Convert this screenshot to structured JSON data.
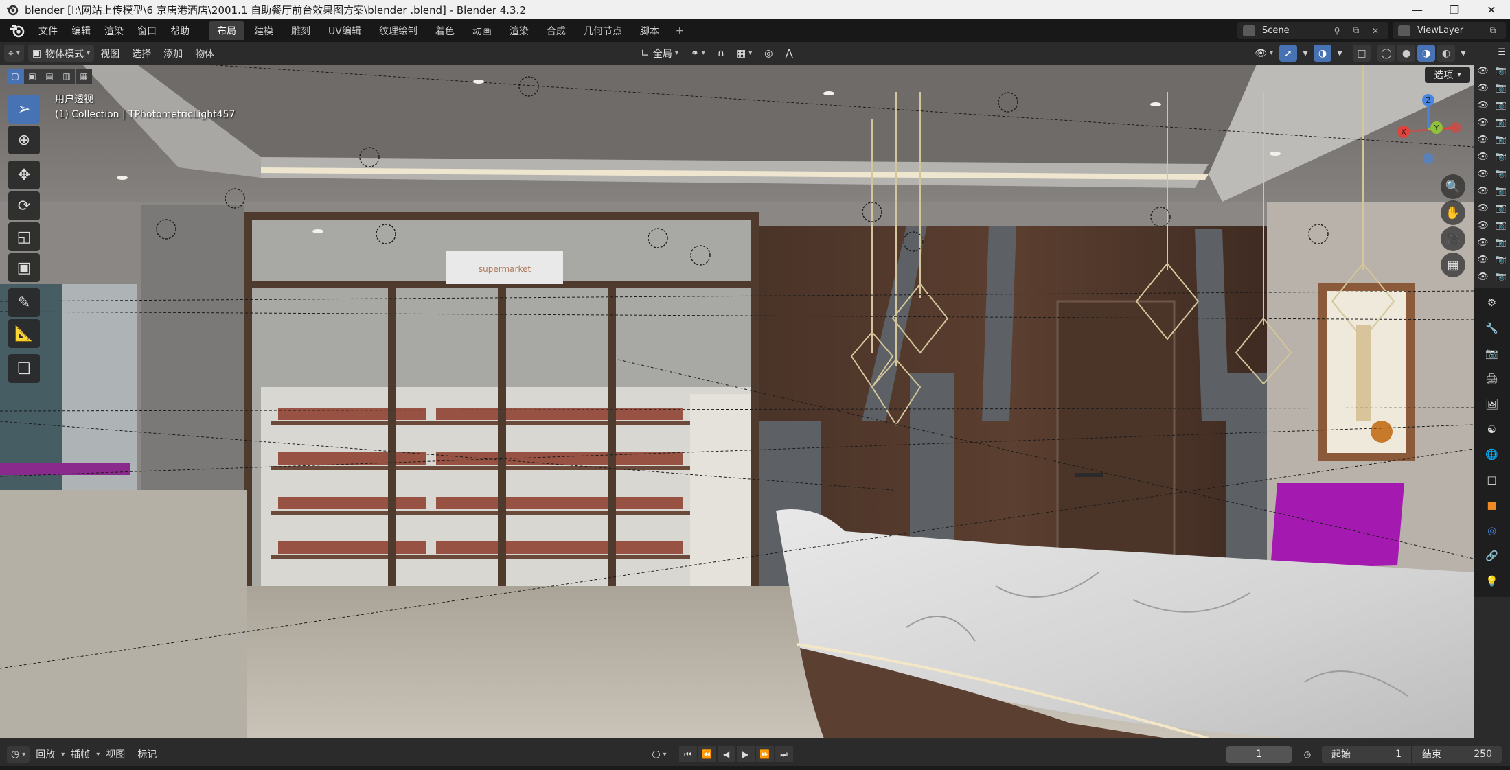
{
  "window": {
    "title": "blender  [I:\\网站上传模型\\6 京唐港酒店\\2001.1 自助餐厅前台效果图方案\\blender .blend] - Blender 4.3.2",
    "controls": [
      "minimize-icon",
      "maximize-icon",
      "close-icon"
    ]
  },
  "menubar": {
    "menus": [
      "文件",
      "编辑",
      "渲染",
      "窗口",
      "帮助"
    ],
    "workspaces": [
      "布局",
      "建模",
      "雕刻",
      "UV编辑",
      "纹理绘制",
      "着色",
      "动画",
      "渲染",
      "合成",
      "几何节点",
      "脚本"
    ],
    "active_workspace": "布局",
    "add_tab": "+",
    "scene": "Scene",
    "view_layer": "ViewLayer"
  },
  "viewport_header": {
    "mode": "物体模式",
    "menus": [
      "视图",
      "选择",
      "添加",
      "物体"
    ],
    "transform_orientation": "全局",
    "options": "选项"
  },
  "viewport": {
    "view_name": "用户透视",
    "collection_info": "(1) Collection | TPhotometricLight457",
    "scene_sign": "supermarket",
    "gizmo_axes": {
      "x": "X",
      "y": "Y",
      "z": "Z"
    },
    "tools": [
      "select-box-icon",
      "cursor-icon",
      "move-icon",
      "rotate-icon",
      "scale-icon",
      "transform-icon",
      "annotate-icon",
      "measure-icon",
      "add-cube-icon"
    ]
  },
  "timeline": {
    "menus": [
      "回放",
      "插帧",
      "视图",
      "标记"
    ],
    "current_frame": "1",
    "start_label": "起始",
    "start": "1",
    "end_label": "结束",
    "end": "250"
  },
  "colors": {
    "accent": "#4772b3",
    "x_axis": "#e0423d",
    "y_axis": "#8fc13a",
    "z_axis": "#4a86e0",
    "background": "#2b2b2b"
  }
}
